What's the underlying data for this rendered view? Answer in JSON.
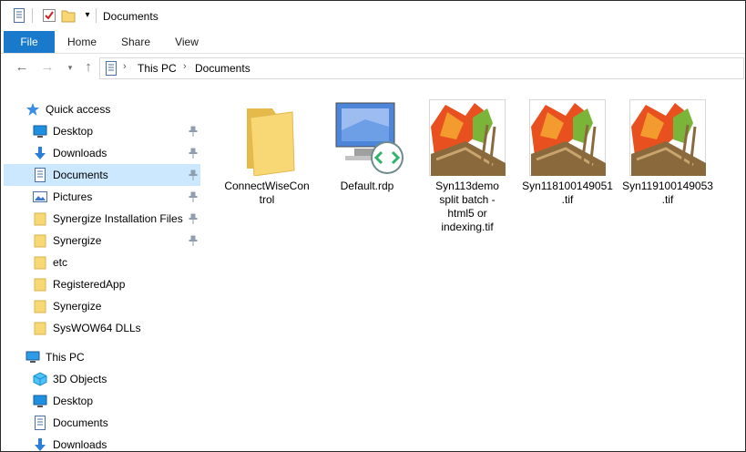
{
  "window": {
    "title": "Documents"
  },
  "ribbon": {
    "tabs": [
      "File",
      "Home",
      "Share",
      "View"
    ]
  },
  "address": {
    "crumbs": [
      "This PC",
      "Documents"
    ]
  },
  "sidebar": {
    "quick_access": {
      "label": "Quick access",
      "items": [
        {
          "label": "Desktop",
          "icon": "desktop-icon",
          "pinned": true
        },
        {
          "label": "Downloads",
          "icon": "download-icon",
          "pinned": true
        },
        {
          "label": "Documents",
          "icon": "documents-icon",
          "pinned": true,
          "selected": true
        },
        {
          "label": "Pictures",
          "icon": "pictures-icon",
          "pinned": true
        },
        {
          "label": "Synergize Installation Files",
          "icon": "folder-icon",
          "pinned": true
        },
        {
          "label": "Synergize",
          "icon": "folder-icon",
          "pinned": true
        },
        {
          "label": "etc",
          "icon": "folder-icon",
          "pinned": false
        },
        {
          "label": "RegisteredApp",
          "icon": "folder-icon",
          "pinned": false
        },
        {
          "label": "Synergize",
          "icon": "folder-icon",
          "pinned": false
        },
        {
          "label": "SysWOW64 DLLs",
          "icon": "folder-icon",
          "pinned": false
        }
      ]
    },
    "this_pc": {
      "label": "This PC",
      "items": [
        {
          "label": "3D Objects",
          "icon": "3d-objects-icon"
        },
        {
          "label": "Desktop",
          "icon": "desktop-icon"
        },
        {
          "label": "Documents",
          "icon": "documents-icon"
        },
        {
          "label": "Downloads",
          "icon": "download-icon"
        }
      ]
    }
  },
  "files": [
    {
      "name": "ConnectWiseControl",
      "lines": [
        "ConnectWiseCon",
        "trol"
      ],
      "type": "folder"
    },
    {
      "name": "Default.rdp",
      "lines": [
        "Default.rdp"
      ],
      "type": "rdp"
    },
    {
      "name": "Syn113demo split batch - html5 or indexing.tif",
      "lines": [
        "Syn113demo",
        "split batch -",
        "html5 or",
        "indexing.tif"
      ],
      "type": "tif"
    },
    {
      "name": "Syn118100149051.tif",
      "lines": [
        "Syn118100149051",
        ".tif"
      ],
      "type": "tif"
    },
    {
      "name": "Syn119100149053.tif",
      "lines": [
        "Syn119100149053",
        ".tif"
      ],
      "type": "tif"
    }
  ],
  "colors": {
    "accent": "#1979ca",
    "selected": "#cce8ff",
    "folder": "#f8d775"
  }
}
